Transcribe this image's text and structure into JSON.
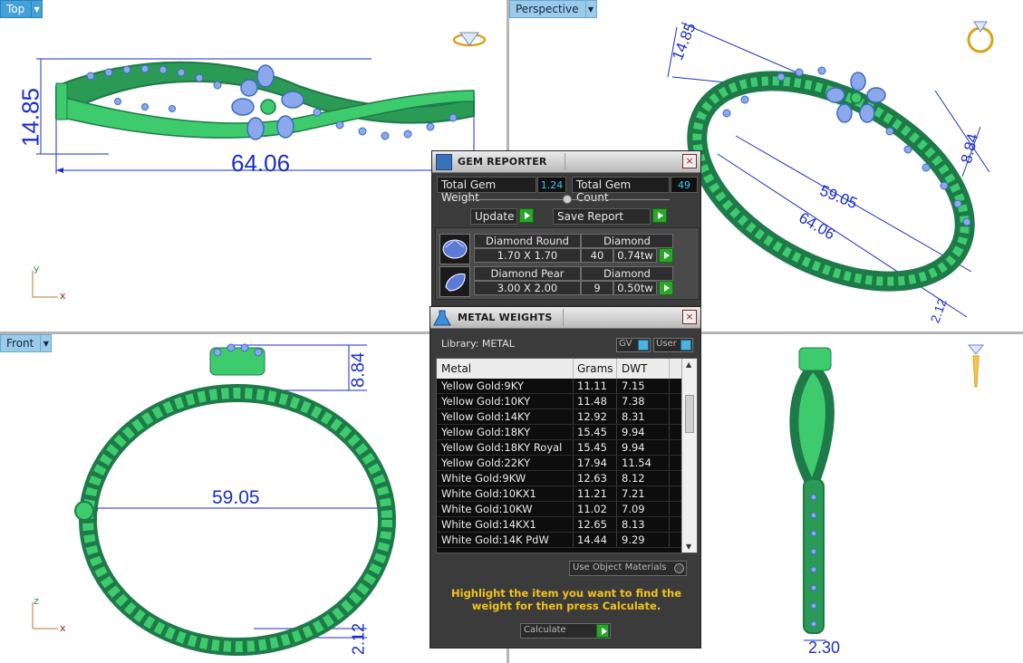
{
  "viewports": {
    "top": {
      "label": "Top",
      "dims": {
        "height": "14.85",
        "width": "64.06"
      },
      "axis": {
        "a": "y",
        "b": "x"
      }
    },
    "perspective": {
      "label": "Perspective",
      "dims": {
        "d1": "14.85",
        "d2": "8.84",
        "d3": "59.05",
        "d4": "64.06",
        "d5": "2.12"
      }
    },
    "front": {
      "label": "Front",
      "dims": {
        "height": "8.84",
        "width": "59.05",
        "bottom": "2.12"
      },
      "axis": {
        "a": "z",
        "b": "x"
      }
    },
    "right": {
      "dims": {
        "bottom": "2.30"
      }
    }
  },
  "gem_reporter": {
    "title": "GEM REPORTER",
    "close": "×",
    "total_weight_label": "Total Gem Weight",
    "total_weight_value": "1.24",
    "total_count_label": "Total Gem Count",
    "total_count_value": "49",
    "update_label": "Update",
    "save_report_label": "Save Report",
    "gems": [
      {
        "name": "Diamond Round",
        "size": "1.70 X 1.70",
        "material": "Diamond",
        "count": "40",
        "weight": "0.74tw"
      },
      {
        "name": "Diamond Pear",
        "size": "3.00 X 2.00",
        "material": "Diamond",
        "count": "9",
        "weight": "0.50tw"
      }
    ]
  },
  "metal_weights": {
    "title": "METAL WEIGHTS",
    "close": "×",
    "library_label": "Library: METAL",
    "gv_label": "GV",
    "user_label": "User",
    "columns": {
      "metal": "Metal",
      "grams": "Grams",
      "dwt": "DWT"
    },
    "rows": [
      {
        "metal": "Yellow Gold:9KY",
        "grams": "11.11",
        "dwt": "7.15"
      },
      {
        "metal": "Yellow Gold:10KY",
        "grams": "11.48",
        "dwt": "7.38"
      },
      {
        "metal": "Yellow Gold:14KY",
        "grams": "12.92",
        "dwt": "8.31"
      },
      {
        "metal": "Yellow Gold:18KY",
        "grams": "15.45",
        "dwt": "9.94"
      },
      {
        "metal": "Yellow Gold:18KY Royal",
        "grams": "15.45",
        "dwt": "9.94"
      },
      {
        "metal": "Yellow Gold:22KY",
        "grams": "17.94",
        "dwt": "11.54"
      },
      {
        "metal": "White Gold:9KW",
        "grams": "12.63",
        "dwt": "8.12"
      },
      {
        "metal": "White Gold:10KX1",
        "grams": "11.21",
        "dwt": "7.21"
      },
      {
        "metal": "White Gold:10KW",
        "grams": "11.02",
        "dwt": "7.09"
      },
      {
        "metal": "White Gold:14KX1",
        "grams": "12.65",
        "dwt": "8.13"
      },
      {
        "metal": "White Gold:14K PdW",
        "grams": "14.44",
        "dwt": "9.29"
      }
    ],
    "use_object_materials_label": "Use Object Materials",
    "instruction": "Highlight the item you want to find the weight for then press Calculate.",
    "calculate_label": "Calculate"
  },
  "colors": {
    "dimension": "#1a2fc8",
    "bangle_dark": "#1e7a48",
    "bangle_light": "#3ecb6e",
    "gem": "#8aa8ea",
    "instruction_text": "#f3c21a",
    "value_text": "#38c7e8"
  }
}
